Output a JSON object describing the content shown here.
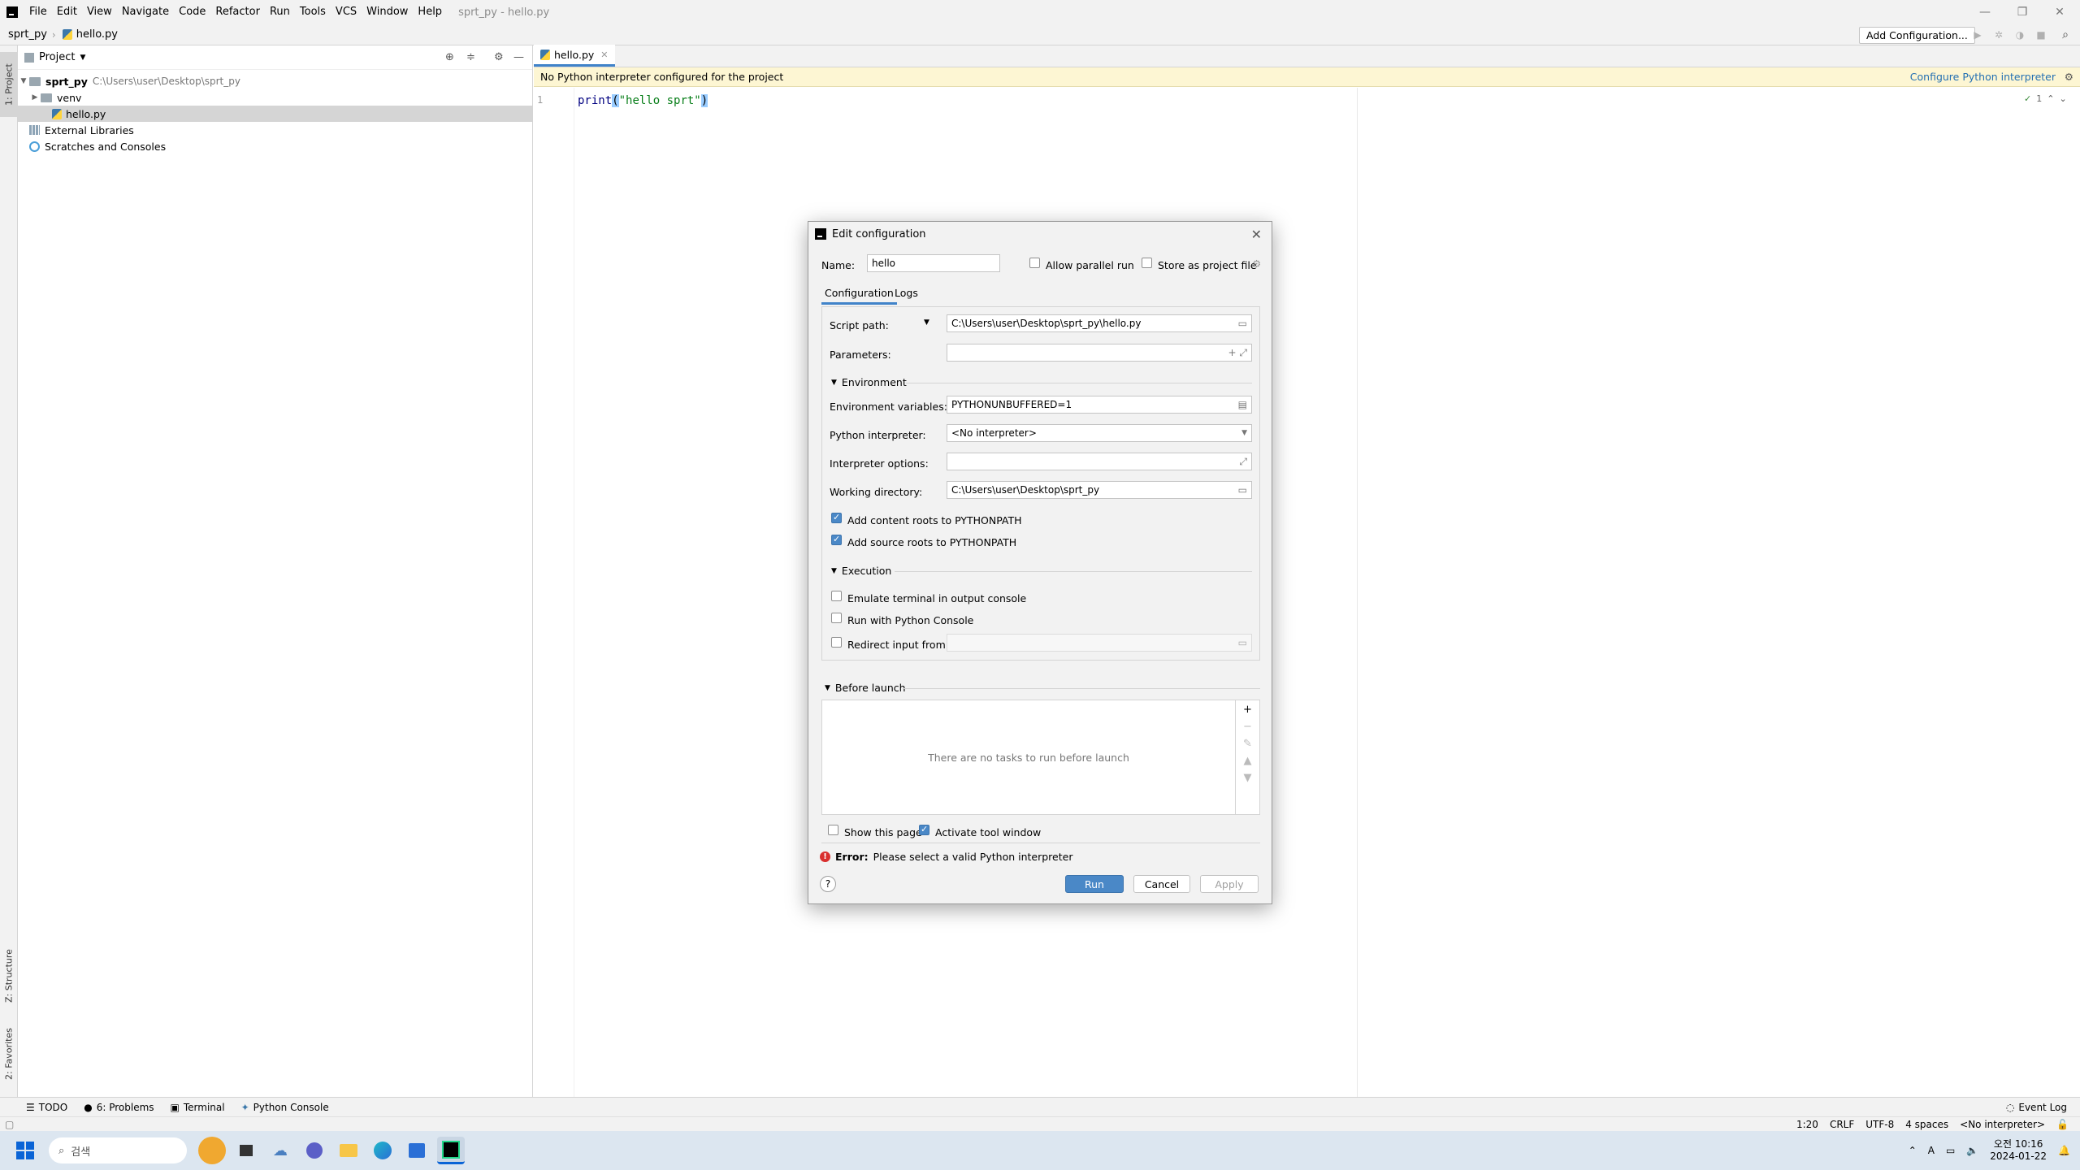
{
  "menubar": {
    "items": [
      "File",
      "Edit",
      "View",
      "Navigate",
      "Code",
      "Refactor",
      "Run",
      "Tools",
      "VCS",
      "Window",
      "Help"
    ],
    "window_title": "sprt_py - hello.py"
  },
  "navbar": {
    "project": "sprt_py",
    "file": "hello.py",
    "add_configuration": "Add Configuration..."
  },
  "side_tabs": {
    "project": "1: Project",
    "structure": "Z: Structure",
    "favorites": "2: Favorites"
  },
  "project_panel": {
    "title": "Project",
    "tree": [
      {
        "label": "sprt_py",
        "path": "C:\\Users\\user\\Desktop\\sprt_py"
      },
      {
        "label": "venv"
      },
      {
        "label": "hello.py"
      },
      {
        "label": "External Libraries"
      },
      {
        "label": "Scratches and Consoles"
      }
    ]
  },
  "editor": {
    "tab_label": "hello.py",
    "banner_text": "No Python interpreter configured for the project",
    "banner_link": "Configure Python interpreter",
    "line_number": "1",
    "code_fn": "print",
    "code_open": "(",
    "code_string": "\"hello sprt\"",
    "code_close": ")",
    "inspection_count": "1"
  },
  "bottom_tabs": [
    "TODO",
    "6: Problems",
    "Terminal",
    "Python Console"
  ],
  "event_log": "Event Log",
  "status": {
    "position": "1:20",
    "line_sep": "CRLF",
    "encoding": "UTF-8",
    "indent": "4 spaces",
    "interpreter": "<No interpreter>"
  },
  "taskbar": {
    "search_placeholder": "검색",
    "time": "오전 10:16",
    "date": "2024-01-22",
    "ime": "A"
  },
  "dialog": {
    "title": "Edit configuration",
    "name_label": "Name:",
    "name_value": "hello",
    "allow_parallel": "Allow parallel run",
    "store_project": "Store as project file",
    "tabs": [
      "Configuration",
      "Logs"
    ],
    "script_path_label": "Script path:",
    "script_path_value": "C:\\Users\\user\\Desktop\\sprt_py\\hello.py",
    "parameters_label": "Parameters:",
    "environment_section": "Environment",
    "env_vars_label": "Environment variables:",
    "env_vars_value": "PYTHONUNBUFFERED=1",
    "interpreter_label": "Python interpreter:",
    "interpreter_value": "<No interpreter>",
    "interp_options_label": "Interpreter options:",
    "working_dir_label": "Working directory:",
    "working_dir_value": "C:\\Users\\user\\Desktop\\sprt_py",
    "add_content_roots": "Add content roots to PYTHONPATH",
    "add_source_roots": "Add source roots to PYTHONPATH",
    "execution_section": "Execution",
    "emulate_terminal": "Emulate terminal in output console",
    "run_with_console": "Run with Python Console",
    "redirect_input": "Redirect input from:",
    "before_launch_section": "Before launch",
    "no_tasks": "There are no tasks to run before launch",
    "show_page": "Show this page",
    "activate_tool": "Activate tool window",
    "error_label": "Error:",
    "error_text": "Please select a valid Python interpreter",
    "run_button": "Run",
    "cancel_button": "Cancel",
    "apply_button": "Apply",
    "help": "?"
  },
  "colors": {
    "accent": "#4a88c7",
    "banner_bg": "#fdf6d3",
    "error": "#d9302f",
    "link": "#2470b3"
  }
}
